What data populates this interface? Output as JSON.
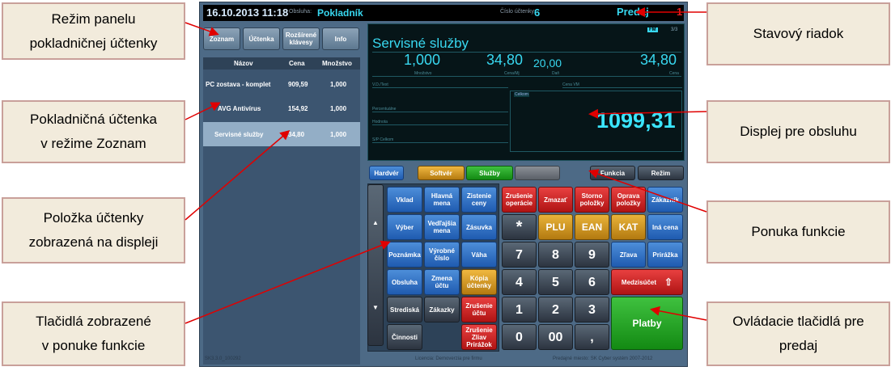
{
  "callouts": {
    "panel_mode": "Režim panelu\npokladničnej účtenky",
    "receipt_list": "Pokladničná účtenka\nv režime Zoznam",
    "item_displayed": "Položka účtenky\nzobrazená  na displeji",
    "function_buttons": "Tlačidlá zobrazené\nv ponuke funkcie",
    "status_bar": "Stavový riadok",
    "operator_display": "Displej pre obsluhu",
    "function_menu": "Ponuka funkcie",
    "sale_controls": "Ovládacie tlačidlá pre\npredaj"
  },
  "status": {
    "datetime": "16.10.2013 11:18",
    "operator_label": "Obsluha:",
    "operator": "Pokladník",
    "receipt_label": "Číslo účtenky:",
    "receipt_number": "6",
    "mode": "Predaj",
    "right_num": "1"
  },
  "toolbar": {
    "list": "Zoznam",
    "receipt": "Účtenka",
    "extended": "Rozšírené klávesy",
    "info": "Info"
  },
  "receipt": {
    "headers": {
      "name": "Názov",
      "price": "Cena",
      "qty": "Množstvo"
    },
    "rows": [
      {
        "name": "PC zostava - komplet",
        "price": "909,59",
        "qty": "1,000"
      },
      {
        "name": "AVG Antivírus",
        "price": "154,92",
        "qty": "1,000"
      },
      {
        "name": "Servisné služby",
        "price": "34,80",
        "qty": "1,000"
      }
    ]
  },
  "display": {
    "title": "Servisné služby",
    "fm": "FM",
    "page": "3/3",
    "quantity": "1,000",
    "unit_price": "34,80",
    "vat": "20,00",
    "amount": "34,80",
    "qty_label": "Množstvo",
    "unit_label": "Cena/Mj",
    "vat_label": "Daň",
    "amount_label": "Cena",
    "vat_text_label": "V.D./Text",
    "price_vm_label": "Cena VM",
    "percent_label": "Percentuálne",
    "value_label": "Hodnota",
    "sp_total_label": "S/P Celkom",
    "total_label": "Celkom",
    "total": "1099,31"
  },
  "tabs": {
    "hardware": "Hardvér",
    "software": "Softvér",
    "services": "Služby",
    "function": "Funkcia",
    "mode": "Režim"
  },
  "functions": {
    "deposit": "Vklad",
    "main_currency": "Hlavná mena",
    "price_check": "Zistenie ceny",
    "withdrawal": "Výber",
    "secondary_currency": "Vedľajšia mena",
    "drawer": "Zásuvka",
    "note": "Poznámka",
    "serial": "Výrobné číslo",
    "scale": "Váha",
    "service": "Obsluha",
    "change_receipt": "Zmena účtu",
    "copy_receipt": "Kópia účtenky",
    "center": "Strediská",
    "orders": "Zákazky",
    "cancel_account": "Zrušenie účtu",
    "activities": "Činnosti",
    "cancel_discount": "Zrušenie Zliav Prirážok"
  },
  "sale": {
    "cancel_operation": "Zrušenie operácie",
    "delete": "Zmazať",
    "storno": "Storno položky",
    "fix_items": "Oprava položky",
    "customer": "Zákazník",
    "asterisk": "*",
    "plu": "PLU",
    "ean": "EAN",
    "kat": "KAT",
    "other_price": "Iná cena",
    "discount": "Zľava",
    "surcharge": "Prirážka",
    "subtotal": "Medzisúčet",
    "pay": "Platby",
    "digits": [
      "7",
      "8",
      "9",
      "4",
      "5",
      "6",
      "1",
      "2",
      "3",
      "0",
      "00",
      ","
    ]
  },
  "footer": {
    "left": "SK3.3.0_100292",
    "center": "Licencia: Demoverzia pre firmu",
    "right": "Predajné miesto: SK Cyber systém 2007-2012"
  }
}
